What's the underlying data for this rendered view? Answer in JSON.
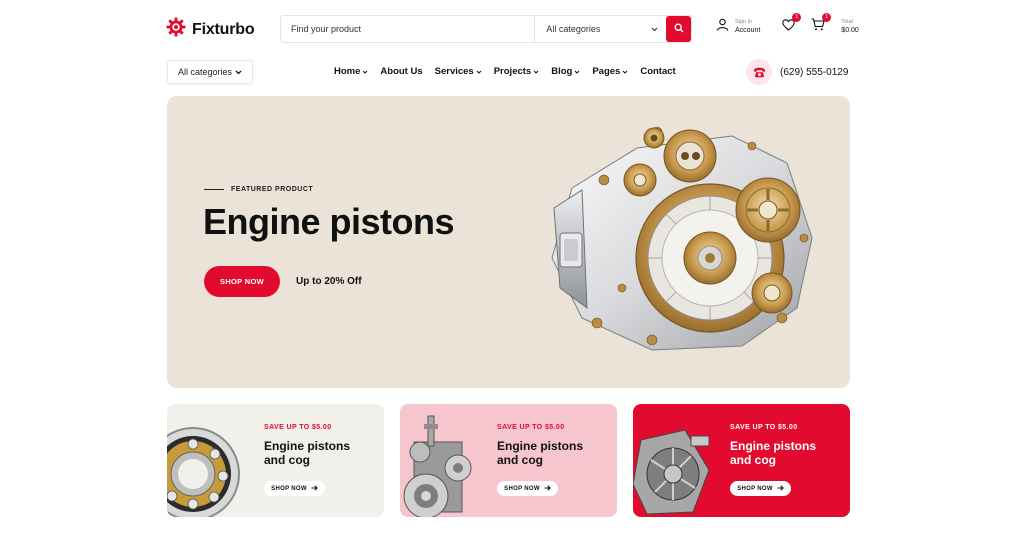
{
  "header": {
    "logo_text": "Fixturbo",
    "search": {
      "placeholder": "Find your product",
      "category": "All categories"
    },
    "account": {
      "sign_in": "Sign In",
      "label": "Account"
    },
    "wishlist_count": "1",
    "cart": {
      "count": "1",
      "total_label": "Total",
      "total_value": "$0.00"
    }
  },
  "nav": {
    "category_button": "All categories",
    "items": [
      {
        "label": "Home",
        "dropdown": true
      },
      {
        "label": "About Us",
        "dropdown": false
      },
      {
        "label": "Services",
        "dropdown": true
      },
      {
        "label": "Projects",
        "dropdown": true
      },
      {
        "label": "Blog",
        "dropdown": true
      },
      {
        "label": "Pages",
        "dropdown": true
      },
      {
        "label": "Contact",
        "dropdown": false
      }
    ],
    "phone": "(629) 555-0129"
  },
  "hero": {
    "tag": "FEATURED PRODUCT",
    "title": "Engine pistons",
    "button": "SHOP NOW",
    "offer": "Up to 20% Off"
  },
  "promos": [
    {
      "save": "SAVE UP TO $5.00",
      "title": "Engine pistons and cog",
      "button": "SHOP NOW",
      "bg": "#f1f0eb",
      "accent": "#e30a2f",
      "text": "#111111"
    },
    {
      "save": "SAVE UP TO $5.00",
      "title": "Engine pistons and cog",
      "button": "SHOP NOW",
      "bg": "#f5c6cd",
      "accent": "#e30a2f",
      "text": "#111111"
    },
    {
      "save": "SAVE UP TO $5.00",
      "title": "Engine pistons and cog",
      "button": "SHOP NOW",
      "bg": "#e30a2f",
      "accent": "#ffffff",
      "text": "#ffffff"
    }
  ],
  "colors": {
    "accent": "#e30a2f",
    "hero_bg": "#ebe2d8"
  }
}
